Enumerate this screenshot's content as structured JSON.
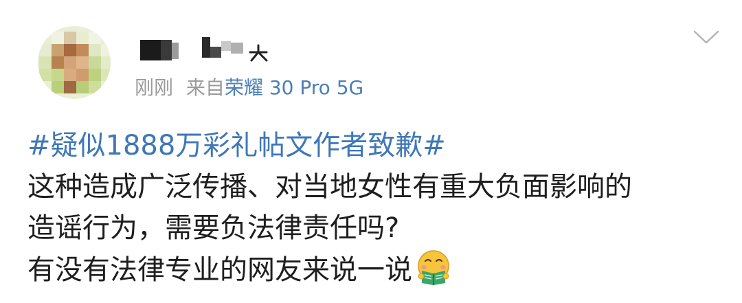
{
  "post": {
    "meta": {
      "time": "刚刚",
      "source_prefix": "来自",
      "device": "荣耀 30 Pro 5G"
    },
    "topic": "#疑似1888万彩礼帖文作者致歉#",
    "lines": [
      "这种造成广泛传播、对当地女性有重大负面影响的",
      "造谣行为，需要负法律责任吗?",
      "有没有法律专业的网友来说一说"
    ],
    "emoji": "nerd-reading-emoji"
  },
  "colors": {
    "link_blue": "#3f77b7",
    "meta_gray": "#9a9a9a",
    "text": "#1e1e1e"
  },
  "icons": {
    "menu": "chevron-down-icon"
  }
}
